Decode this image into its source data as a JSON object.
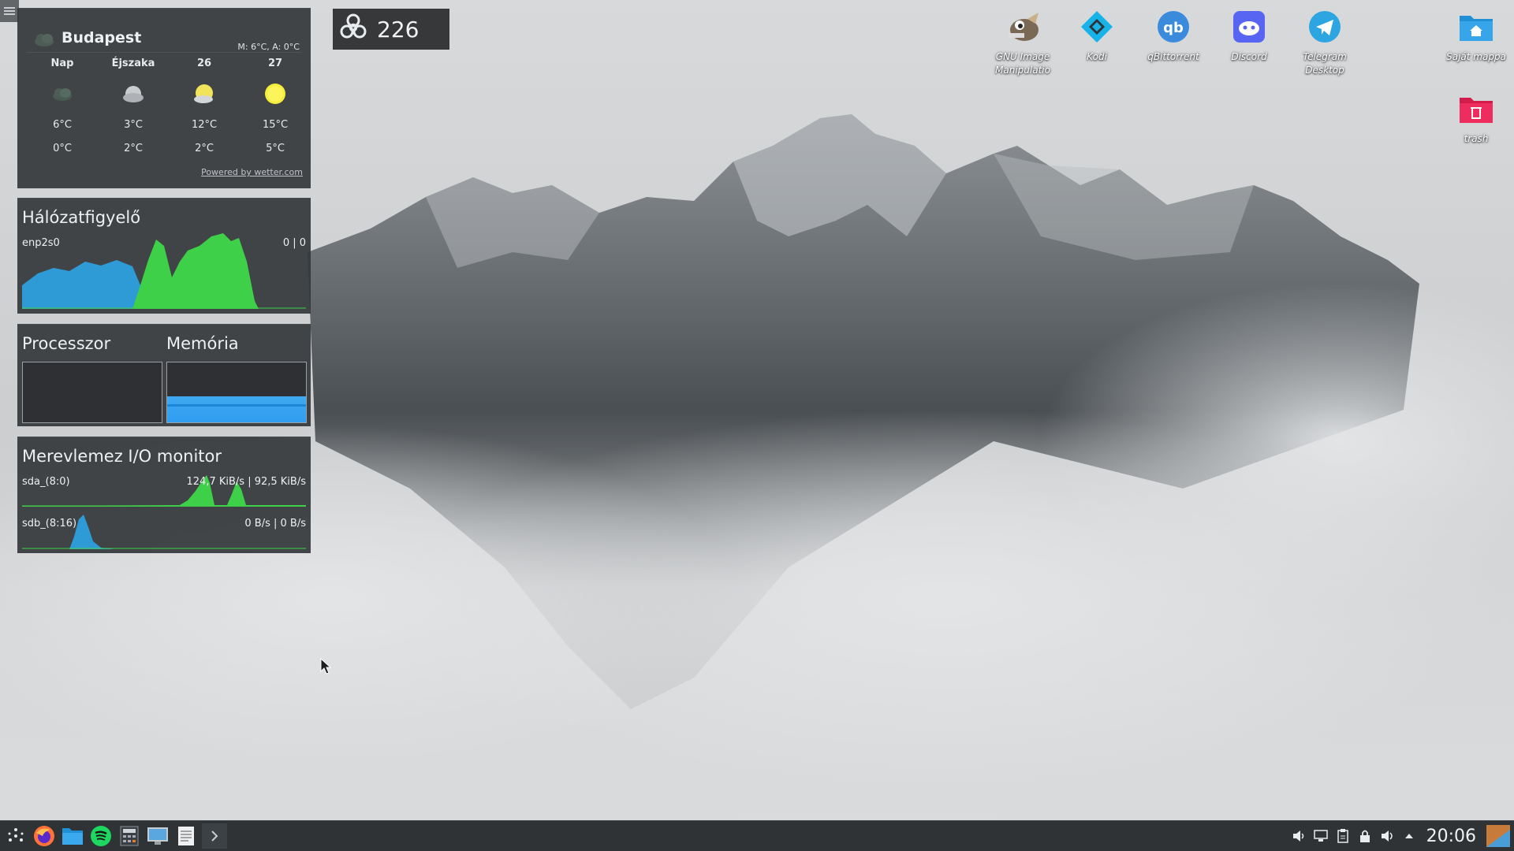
{
  "weather": {
    "location": "Budapest",
    "minmax": "M: 6°C, A: 0°C",
    "days": [
      {
        "label": "Nap",
        "icon": "cloud-dark-icon",
        "high": "6°C",
        "low": "0°C"
      },
      {
        "label": "Éjszaka",
        "icon": "cloud-icon",
        "high": "3°C",
        "low": "2°C"
      },
      {
        "label": "26",
        "icon": "partly-sunny-icon",
        "high": "12°C",
        "low": "2°C"
      },
      {
        "label": "27",
        "icon": "sun-icon",
        "high": "15°C",
        "low": "5°C"
      }
    ],
    "credit": "Powered by wetter.com"
  },
  "badge": {
    "icon": "biohazard-icon",
    "value": "226"
  },
  "network": {
    "title": "Hálózatfigyelő",
    "interface": "enp2s0",
    "values": "0 | 0",
    "colors": {
      "download": "#2f9bd6",
      "upload": "#3fd04a"
    }
  },
  "system": {
    "cpu_title": "Processzor",
    "mem_title": "Memória",
    "cpu_load": 0.0,
    "mem_usage": 0.44,
    "accent": "#3fa8f0"
  },
  "disk": {
    "title": "Merevlemez I/O monitor",
    "rows": [
      {
        "name": "sda_(8:0)",
        "values": "124,7 KiB/s | 92,5 KiB/s"
      },
      {
        "name": "sdb_(8:16)",
        "values": "0 B/s | 0 B/s"
      }
    ]
  },
  "desktop_icons": [
    {
      "label": "GNU Image Manipulatio",
      "icon": "gimp-icon"
    },
    {
      "label": "Kodi",
      "icon": "kodi-icon"
    },
    {
      "label": "qBittorrent",
      "icon": "qbittorrent-icon"
    },
    {
      "label": "Discord",
      "icon": "discord-icon"
    },
    {
      "label": "Telegram Desktop",
      "icon": "telegram-icon"
    },
    {
      "label": "Saját mappa",
      "icon": "home-folder-icon"
    },
    {
      "label": "trash",
      "icon": "trash-icon"
    }
  ],
  "taskbar": {
    "launchers": [
      "app-launcher-icon",
      "firefox-icon",
      "file-manager-icon",
      "spotify-icon",
      "calculator-icon",
      "system-monitor-icon",
      "text-editor-icon",
      "expand-arrow-icon"
    ],
    "tray": [
      "speaker-icon",
      "network-icon",
      "clipboard-icon",
      "lock-icon",
      "volume-icon",
      "tray-expand-icon"
    ],
    "clock": "20:06"
  }
}
